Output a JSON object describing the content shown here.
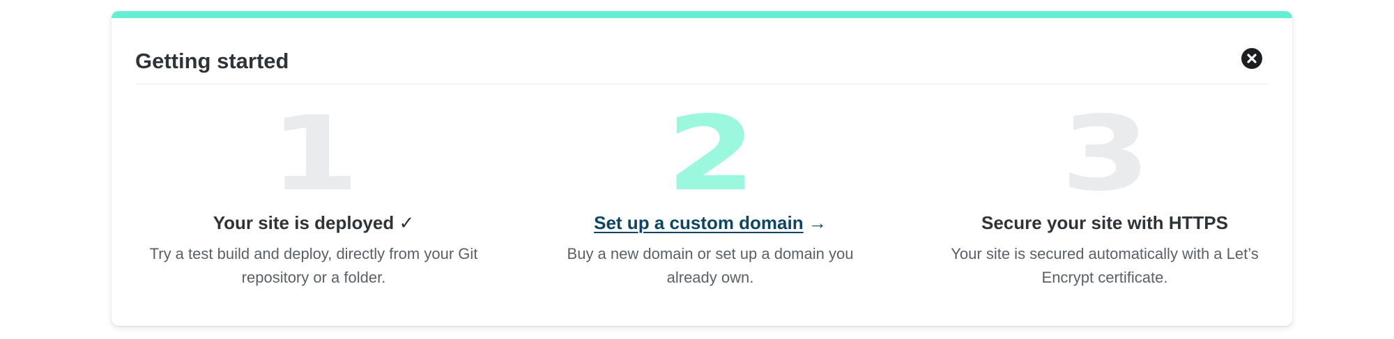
{
  "colors": {
    "accent": "#64eed6",
    "number_muted": "#eaebed",
    "number_active": "#9bf7de",
    "link": "#0e4661"
  },
  "card": {
    "title": "Getting started",
    "close_icon": "close-circle-icon"
  },
  "steps": [
    {
      "number": "1",
      "heading": "Your site is deployed",
      "status_mark": "✓",
      "description": "Try a test build and deploy, directly from your Git repository or a folder."
    },
    {
      "number": "2",
      "heading": "Set up a custom domain",
      "arrow": "→",
      "description": "Buy a new domain or set up a domain you already own."
    },
    {
      "number": "3",
      "heading": "Secure your site with HTTPS",
      "description": "Your site is secured automatically with a Let’s Encrypt certificate."
    }
  ]
}
